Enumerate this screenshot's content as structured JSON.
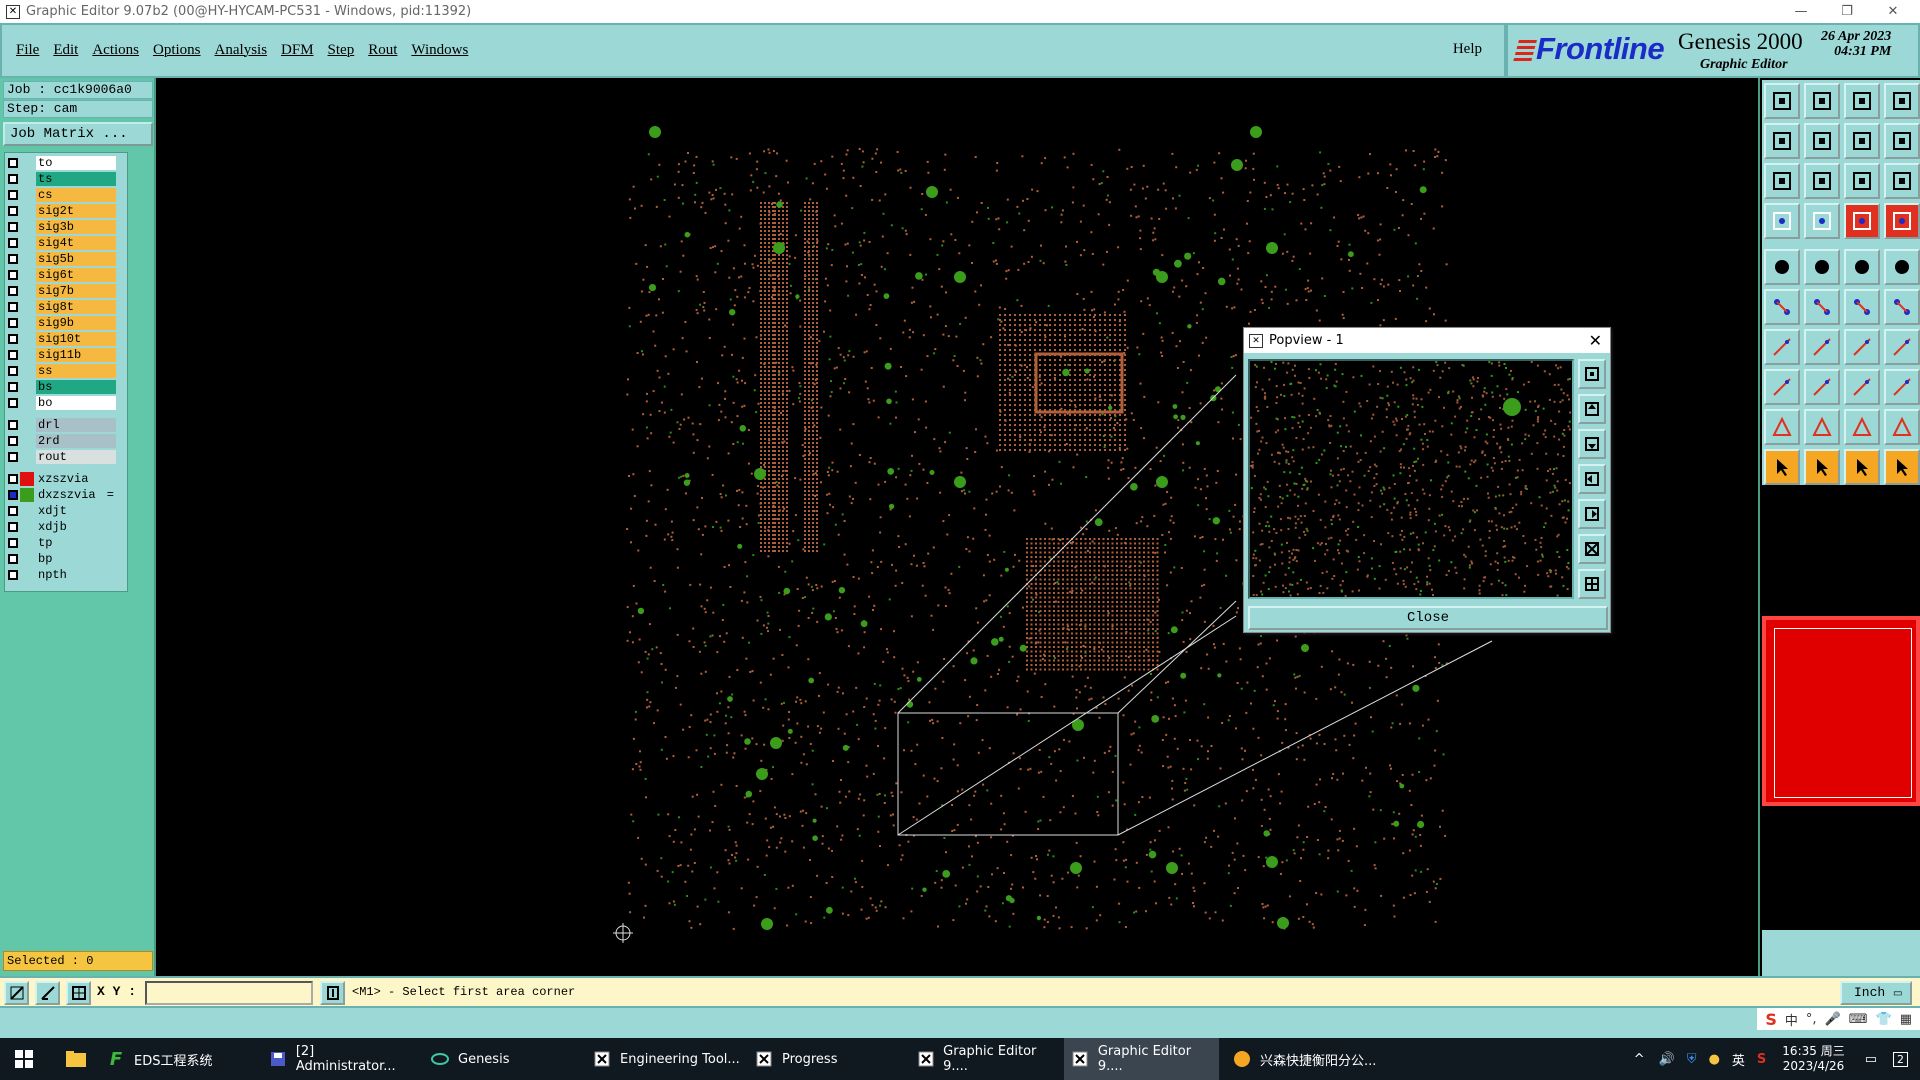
{
  "window": {
    "title": "Graphic Editor 9.07b2 (00@HY-HYCAM-PC531 - Windows, pid:11392)"
  },
  "menu": {
    "items": [
      "File",
      "Edit",
      "Actions",
      "Options",
      "Analysis",
      "DFM",
      "Step",
      "Rout",
      "Windows"
    ],
    "help": "Help"
  },
  "brand": {
    "logo": "Frontline",
    "product": "Genesis 2000",
    "subtitle": "Graphic Editor",
    "date": "26 Apr 2023",
    "time": "04:31 PM"
  },
  "job": {
    "job_line": "Job : cc1k9006a0",
    "step_line": "Step: cam",
    "matrix_button": "Job Matrix ..."
  },
  "layers": {
    "group1": [
      {
        "name": "to",
        "color": "#ffffff",
        "checked": false
      },
      {
        "name": "ts",
        "color": "#20a884",
        "checked": false
      },
      {
        "name": "cs",
        "color": "#f5b942",
        "checked": false
      },
      {
        "name": "sig2t",
        "color": "#f5b942",
        "checked": false
      },
      {
        "name": "sig3b",
        "color": "#f5b942",
        "checked": false
      },
      {
        "name": "sig4t",
        "color": "#f5b942",
        "checked": false
      },
      {
        "name": "sig5b",
        "color": "#f5b942",
        "checked": false
      },
      {
        "name": "sig6t",
        "color": "#f5b942",
        "checked": false
      },
      {
        "name": "sig7b",
        "color": "#f5b942",
        "checked": false
      },
      {
        "name": "sig8t",
        "color": "#f5b942",
        "checked": false
      },
      {
        "name": "sig9b",
        "color": "#f5b942",
        "checked": false
      },
      {
        "name": "sig10t",
        "color": "#f5b942",
        "checked": false
      },
      {
        "name": "sig11b",
        "color": "#f5b942",
        "checked": false
      },
      {
        "name": "ss",
        "color": "#f5b942",
        "checked": false
      },
      {
        "name": "bs",
        "color": "#20a884",
        "checked": false
      },
      {
        "name": "bo",
        "color": "#ffffff",
        "checked": false
      }
    ],
    "group2": [
      {
        "name": "drl",
        "color": "#a8c0c8",
        "checked": false
      },
      {
        "name": "2rd",
        "color": "#a8c0c8",
        "checked": false
      },
      {
        "name": "rout",
        "color": "#d8e0e0",
        "checked": false
      }
    ],
    "group3": [
      {
        "name": "xzszvia",
        "color": "#9cd8d6",
        "swatch": "#e01010",
        "checked": false
      },
      {
        "name": "dxzszvia",
        "color": "#9cd8d6",
        "swatch": "#3c9c1c",
        "checked": true,
        "flag": "="
      },
      {
        "name": "xdjt",
        "color": "#9cd8d6",
        "checked": false
      },
      {
        "name": "xdjb",
        "color": "#9cd8d6",
        "checked": false
      },
      {
        "name": "tp",
        "color": "#9cd8d6",
        "checked": false
      },
      {
        "name": "bp",
        "color": "#9cd8d6",
        "checked": false
      },
      {
        "name": "npth",
        "color": "#9cd8d6",
        "checked": false
      }
    ]
  },
  "selected": "Selected : 0",
  "popview": {
    "title": "Popview - 1",
    "close_label": "Close"
  },
  "status": {
    "xy_label": "X Y :",
    "xy_value": "",
    "prompt": "<M1> - Select first area corner",
    "unit": "Inch"
  },
  "ime": {
    "items": [
      "中",
      "°,",
      "英"
    ]
  },
  "taskbar": {
    "tasks": [
      {
        "label": "EDS工程系统",
        "icon": "f-icon"
      },
      {
        "label": "[2] Administrator...",
        "icon": "floppy-icon"
      },
      {
        "label": "Genesis",
        "icon": "genesis-icon"
      },
      {
        "label": "Engineering Tool...",
        "icon": "x-window-icon"
      },
      {
        "label": "Progress",
        "icon": "x-window-icon"
      },
      {
        "label": "Graphic Editor 9....",
        "icon": "x-window-icon"
      },
      {
        "label": "Graphic Editor 9....",
        "icon": "x-window-icon"
      },
      {
        "label": "兴森快捷衡阳分公...",
        "icon": "browser-icon"
      }
    ],
    "tray_lang": "英",
    "clock_time": "16:35 周三",
    "clock_date": "2023/4/26",
    "notification_count": "2"
  },
  "colors": {
    "panel": "#9cd8d6",
    "panel_green": "#62c6a8",
    "via_green": "#3c9c1c",
    "trace_orange": "#b0603a",
    "thumb_red": "#e00000"
  }
}
